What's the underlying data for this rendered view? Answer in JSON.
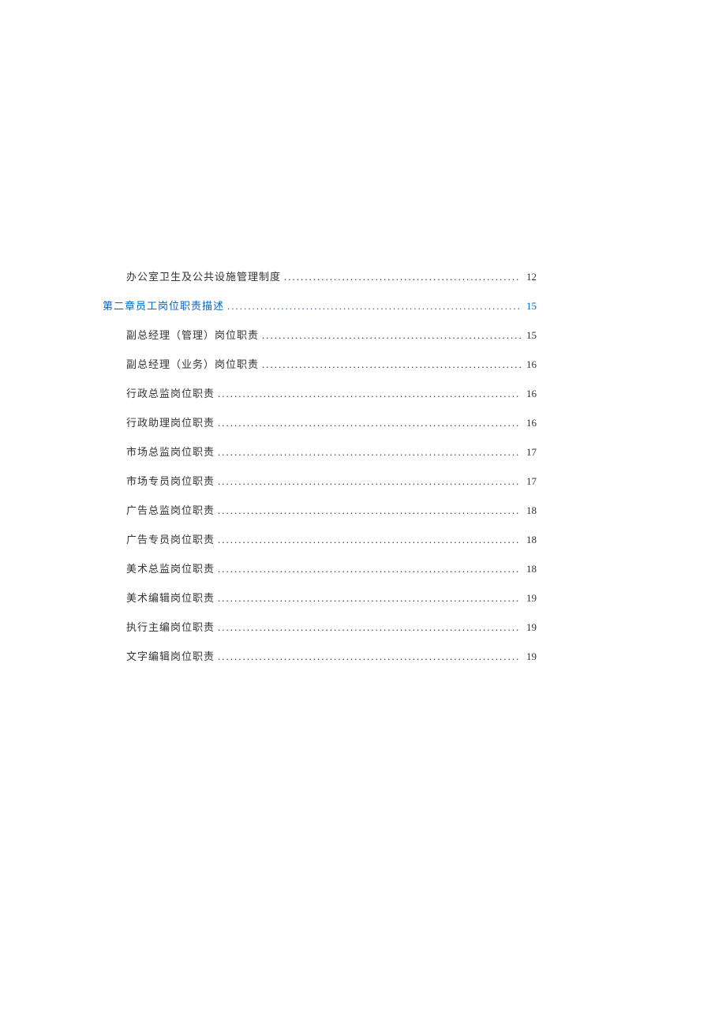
{
  "toc": {
    "entries": [
      {
        "indent": 1,
        "title": "办公室卫生及公共设施管理制度",
        "page": "12",
        "isLink": false
      },
      {
        "indent": 0,
        "title": "第二章员工岗位职责描述",
        "page": "15",
        "isLink": true
      },
      {
        "indent": 1,
        "title": "副总经理（管理）岗位职责",
        "page": "15",
        "isLink": false
      },
      {
        "indent": 1,
        "title": "副总经理（业务）岗位职责",
        "page": "16",
        "isLink": false
      },
      {
        "indent": 1,
        "title": "行政总监岗位职责",
        "page": "16",
        "isLink": false
      },
      {
        "indent": 1,
        "title": "行政助理岗位职责",
        "page": "16",
        "isLink": false
      },
      {
        "indent": 1,
        "title": "市场总监岗位职责",
        "page": "17",
        "isLink": false
      },
      {
        "indent": 1,
        "title": "市场专员岗位职责",
        "page": "17",
        "isLink": false
      },
      {
        "indent": 1,
        "title": "广告总监岗位职责",
        "page": "18",
        "isLink": false
      },
      {
        "indent": 1,
        "title": "广告专员岗位职责",
        "page": "18",
        "isLink": false
      },
      {
        "indent": 1,
        "title": "美术总监岗位职责",
        "page": "18",
        "isLink": false
      },
      {
        "indent": 1,
        "title": "美术编辑岗位职责",
        "page": "19",
        "isLink": false
      },
      {
        "indent": 1,
        "title": "执行主编岗位职责",
        "page": "19",
        "isLink": false
      },
      {
        "indent": 1,
        "title": "文字编辑岗位职责",
        "page": "19",
        "isLink": false
      }
    ]
  }
}
